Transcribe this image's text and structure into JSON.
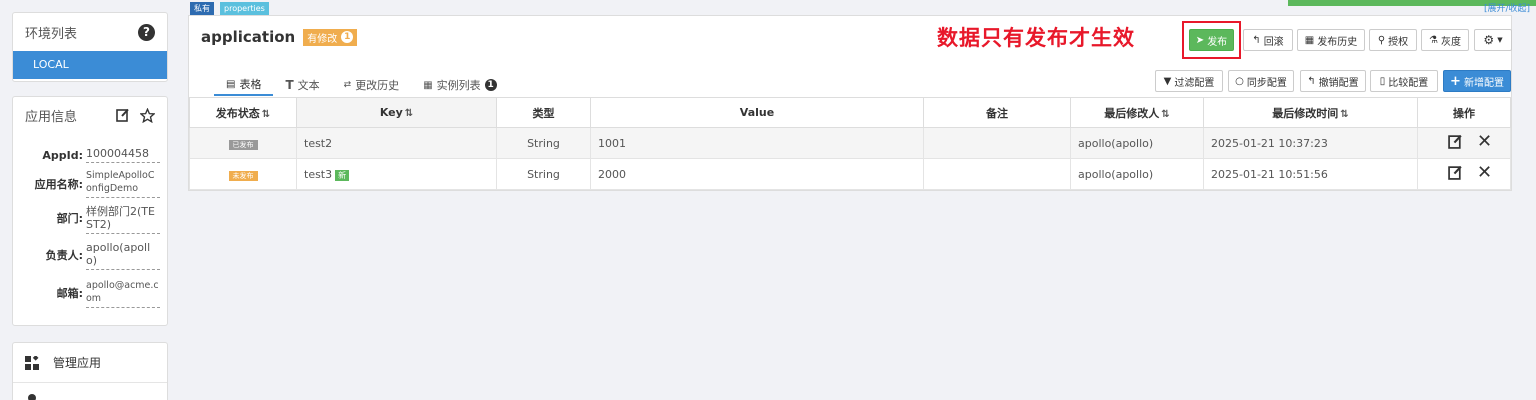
{
  "env": {
    "title": "环境列表",
    "items": [
      "LOCAL"
    ]
  },
  "appinfo": {
    "title": "应用信息",
    "rows": [
      {
        "key": "AppId:",
        "value": "100004458"
      },
      {
        "key": "应用名称:",
        "value": "SimpleApolloConfigDemo"
      },
      {
        "key": "部门:",
        "value": "样例部门2(TEST2)"
      },
      {
        "key": "负责人:",
        "value": "apollo(apollo)"
      },
      {
        "key": "邮箱:",
        "value": "apollo@acme.com"
      }
    ]
  },
  "sidemenu": {
    "items": [
      "管理应用"
    ]
  },
  "namespace": {
    "scope_tag": "私有",
    "format_tag": "properties",
    "name": "application",
    "modified_label": "有修改",
    "modified_count": "1",
    "top_right_link": "[展开/收起]"
  },
  "annotation": "数据只有发布才生效",
  "toolbar": {
    "publish": "发布",
    "rollback": "回滚",
    "history": "发布历史",
    "grant": "授权",
    "gray": "灰度"
  },
  "tabs": [
    {
      "label": "表格"
    },
    {
      "label": "文本"
    },
    {
      "label": "更改历史"
    },
    {
      "label": "实例列表",
      "badge": "1"
    }
  ],
  "actions": {
    "filter": "过滤配置",
    "sync": "同步配置",
    "revoke": "撤销配置",
    "compare": "比较配置",
    "add": "新增配置"
  },
  "table": {
    "headers": {
      "status": "发布状态",
      "key": "Key",
      "type": "类型",
      "value": "Value",
      "comment": "备注",
      "modifier": "最后修改人",
      "time": "最后修改时间",
      "ops": "操作"
    },
    "rows": [
      {
        "status": "已发布",
        "key": "test2",
        "new": "",
        "type": "String",
        "value": "1001",
        "comment": "",
        "modifier": "apollo(apollo)",
        "time": "2025-01-21 10:37:23"
      },
      {
        "status": "未发布",
        "key": "test3",
        "new": "新",
        "type": "String",
        "value": "2000",
        "comment": "",
        "modifier": "apollo(apollo)",
        "time": "2025-01-21 10:51:56"
      }
    ]
  },
  "colors": {
    "accent": "#3b8cd6",
    "success": "#5cb85c",
    "warning": "#f0ad4e",
    "annotation": "#e8182a"
  }
}
